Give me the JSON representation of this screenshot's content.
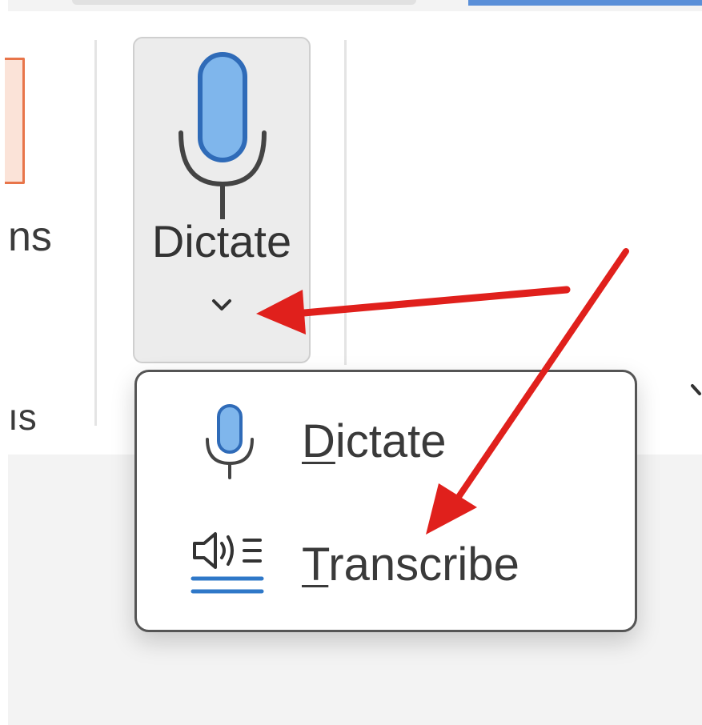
{
  "ribbon": {
    "partial_group_label_top": "ns",
    "partial_group_label_bottom": "ıs",
    "dictate_button": {
      "label": "Dictate",
      "icon": "microphone-icon",
      "dropdown_icon": "chevron-down-icon"
    }
  },
  "dropdown_menu": {
    "items": [
      {
        "mnemonic": "D",
        "rest": "ictate",
        "icon": "microphone-icon"
      },
      {
        "mnemonic": "T",
        "rest": "ranscribe",
        "icon": "transcribe-icon"
      }
    ]
  },
  "annotations": {
    "arrow_color": "#e0201c"
  },
  "colors": {
    "mic_fill": "#7fb6ec",
    "mic_outline": "#2f6bb8",
    "icon_gray": "#444444",
    "menu_border": "#555555",
    "button_hover_bg": "#ececec"
  }
}
